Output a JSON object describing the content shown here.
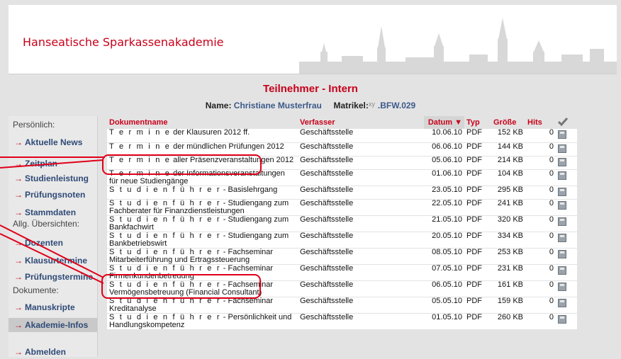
{
  "header": {
    "brand": "Hanseatische Sparkassenakademie"
  },
  "page": {
    "title": "Teilnehmer - Intern",
    "name_label": "Name:",
    "name_value": "Christiane Musterfrau",
    "matrikel_label": "Matrikel:",
    "matrikel_sup": "xy",
    "matrikel_value": ".BFW.029"
  },
  "sidebar": {
    "sections": [
      {
        "heading": "Persönlich:",
        "items": [
          "Aktuelle News",
          "Zeitplan",
          "Studienleistung",
          "Prüfungsnoten",
          "Stammdaten"
        ]
      },
      {
        "heading": "Allg. Übersichten:",
        "items": [
          "Dozenten",
          "Klausurtermine",
          "Prüfungstermine"
        ]
      },
      {
        "heading": "Dokumente:",
        "items": [
          "Manuskripte",
          "Akademie-Infos"
        ]
      }
    ],
    "logout": "Abmelden",
    "active_item": "Akademie-Infos"
  },
  "table": {
    "headers": [
      "Dokumentname",
      "Verfasser",
      "Datum ▼",
      "Typ",
      "Größe",
      "Hits",
      ""
    ],
    "rows": [
      {
        "prefix": "T e r m i n e",
        "rest": " der Klausuren 2012 ff.",
        "author": "Geschäftsstelle",
        "date": "10.06.10",
        "type": "PDF",
        "size": "152 KB",
        "hits": "0"
      },
      {
        "prefix": "T e r m i n e",
        "rest": " der mündlichen Prüfungen 2012",
        "author": "Geschäftsstelle",
        "date": "06.06.10",
        "type": "PDF",
        "size": "144 KB",
        "hits": "0"
      },
      {
        "prefix": "T e r m i n e",
        "rest": " aller Präsenzveranstaltungen 2012",
        "author": "Geschäftsstelle",
        "date": "05.06.10",
        "type": "PDF",
        "size": "214 KB",
        "hits": "0"
      },
      {
        "prefix": "T e r m i n e",
        "rest": " der Informationsveranstaltungen für neue Studiengänge",
        "author": "Geschäftsstelle",
        "date": "01.06.10",
        "type": "PDF",
        "size": "104 KB",
        "hits": "0"
      },
      {
        "prefix": "S t u d i e n f ü h r e r",
        "rest": " - Basislehrgang",
        "author": "Geschäftsstelle",
        "date": "23.05.10",
        "type": "PDF",
        "size": "295 KB",
        "hits": "0"
      },
      {
        "prefix": "S t u d i e n f ü h r e r",
        "rest": " - Studiengang zum Fachberater für Finanzdienstleistungen",
        "author": "Geschäftsstelle",
        "date": "22.05.10",
        "type": "PDF",
        "size": "241 KB",
        "hits": "0"
      },
      {
        "prefix": "S t u d i e n f ü h r e r",
        "rest": " - Studiengang zum Bankfachwirt",
        "author": "Geschäftsstelle",
        "date": "21.05.10",
        "type": "PDF",
        "size": "320 KB",
        "hits": "0"
      },
      {
        "prefix": "S t u d i e n f ü h r e r",
        "rest": " - Studiengang zum Bankbetriebswirt",
        "author": "Geschäftsstelle",
        "date": "20.05.10",
        "type": "PDF",
        "size": "334 KB",
        "hits": "0"
      },
      {
        "prefix": "S t u d i e n f ü h r e r",
        "rest": " - Fachseminar Mitarbeiterführung und Ertragssteuerung",
        "author": "Geschäftsstelle",
        "date": "08.05.10",
        "type": "PDF",
        "size": "253 KB",
        "hits": "0"
      },
      {
        "prefix": "S t u d i e n f ü h r e r",
        "rest": " - Fachseminar Firmenkundenbetreuung",
        "author": "Geschäftsstelle",
        "date": "07.05.10",
        "type": "PDF",
        "size": "231 KB",
        "hits": "0"
      },
      {
        "prefix": "S t u d i e n f ü h r e r",
        "rest": " - Fachseminar Vermögensbetreuung (Financial Consultant)",
        "author": "Geschäftsstelle",
        "date": "06.05.10",
        "type": "PDF",
        "size": "161 KB",
        "hits": "0"
      },
      {
        "prefix": "S t u d i e n f ü h r e r",
        "rest": " - Fachseminar Kreditanalyse",
        "author": "Geschäftsstelle",
        "date": "05.05.10",
        "type": "PDF",
        "size": "159 KB",
        "hits": "0"
      },
      {
        "prefix": "S t u d i e n f ü h r e r",
        "rest": " - Persönlichkeit und Handlungskompetenz",
        "author": "Geschäftsstelle",
        "date": "01.05.10",
        "type": "PDF",
        "size": "260 KB",
        "hits": "0"
      }
    ]
  },
  "colors": {
    "accent": "#c8001a",
    "link": "#2f4a77",
    "annotation": "#e0001a"
  }
}
